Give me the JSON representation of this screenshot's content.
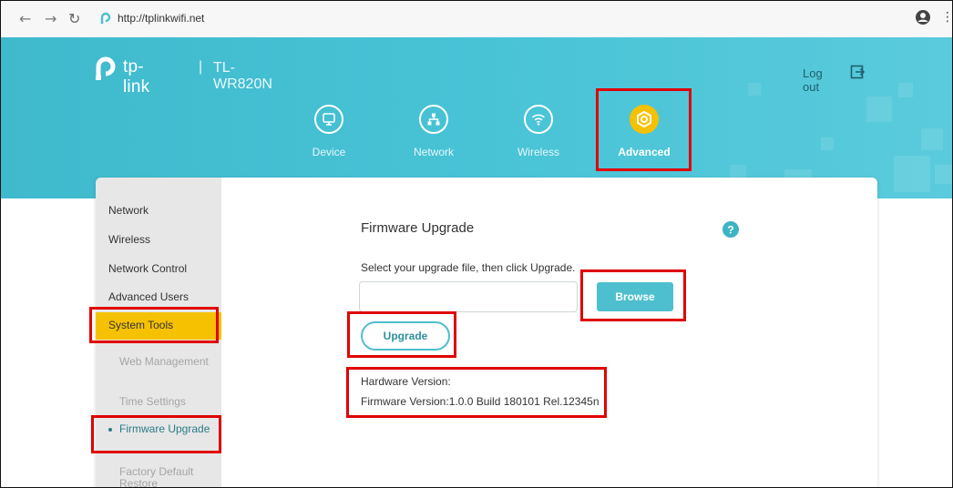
{
  "browser": {
    "url": "http://tplinkwifi.net",
    "back_icon": "arrow-left",
    "forward_icon": "arrow-right",
    "reload_icon": "reload"
  },
  "header": {
    "brand": "tp-link",
    "separator": "|",
    "model": "TL-WR820N",
    "logout_label": "Log out",
    "tabs": [
      {
        "label": "Device",
        "icon": "monitor-icon",
        "active": false
      },
      {
        "label": "Network",
        "icon": "network-icon",
        "active": false
      },
      {
        "label": "Wireless",
        "icon": "wifi-icon",
        "active": false
      },
      {
        "label": "Advanced",
        "icon": "gear-icon",
        "active": true
      }
    ]
  },
  "sidebar": {
    "items": [
      "Network",
      "Wireless",
      "Network Control",
      "Advanced Users",
      "System Tools"
    ],
    "selected": "System Tools",
    "sub_items": [
      "Web Management",
      "Time Settings",
      "Firmware Upgrade",
      "Factory Default Restore"
    ],
    "active_sub_item": "Firmware Upgrade"
  },
  "content": {
    "title": "Firmware Upgrade",
    "instruction": "Select your upgrade file, then click Upgrade.",
    "file_value": "",
    "browse_label": "Browse",
    "upgrade_label": "Upgrade",
    "hardware_version": "Hardware Version:",
    "firmware_version": "Firmware Version:1.0.0 Build 180101 Rel.12345n"
  },
  "colors": {
    "header_bg": "#48c3d6",
    "accent_yellow": "#f5c100",
    "button_teal": "#4dbfce",
    "annotation_red": "#e00000"
  }
}
